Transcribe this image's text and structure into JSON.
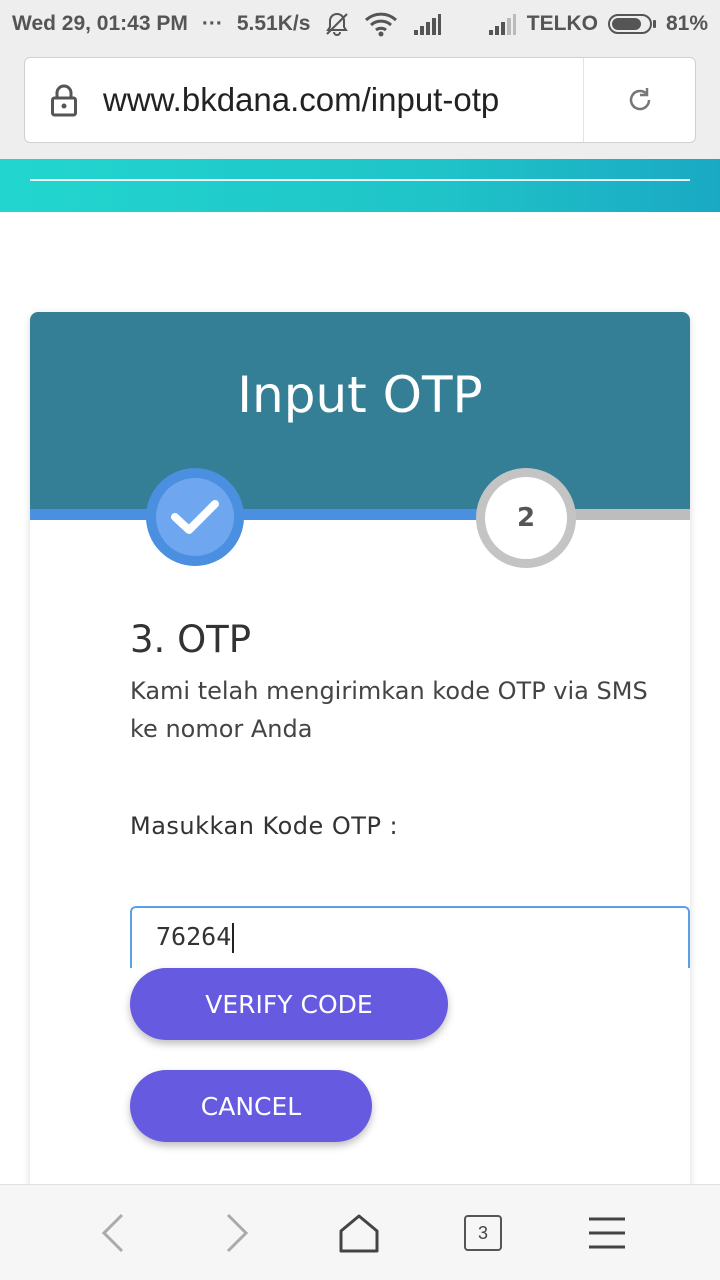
{
  "statusbar": {
    "datetime": "Wed 29, 01:43 PM",
    "dots": "···",
    "speed": "5.51K/s",
    "carrier": "TELKO",
    "battery_percent": "81%",
    "battery_level": 0.81,
    "icons": [
      "mute-bell-icon",
      "wifi-icon",
      "signal-icon",
      "signal-icon"
    ]
  },
  "browser": {
    "url": "www.bkdana.com/input-otp",
    "tab_count": "3",
    "icons": [
      "lock-icon",
      "reload-icon",
      "back-icon",
      "forward-icon",
      "home-icon",
      "tabs-icon",
      "menu-icon"
    ]
  },
  "colors": {
    "header_teal": "#1fc4c8",
    "card_header": "#357f96",
    "step_active": "#4a8fe0",
    "button": "#665ae0"
  },
  "card": {
    "title": "Input OTP",
    "step2_label": "2",
    "section_heading": "3. OTP",
    "section_description": "Kami telah mengirimkan kode OTP via SMS ke nomor Anda",
    "otp_label": "Masukkan Kode OTP :",
    "otp_value": "76264",
    "verify_button": "VERIFY CODE",
    "cancel_button": "CANCEL"
  }
}
